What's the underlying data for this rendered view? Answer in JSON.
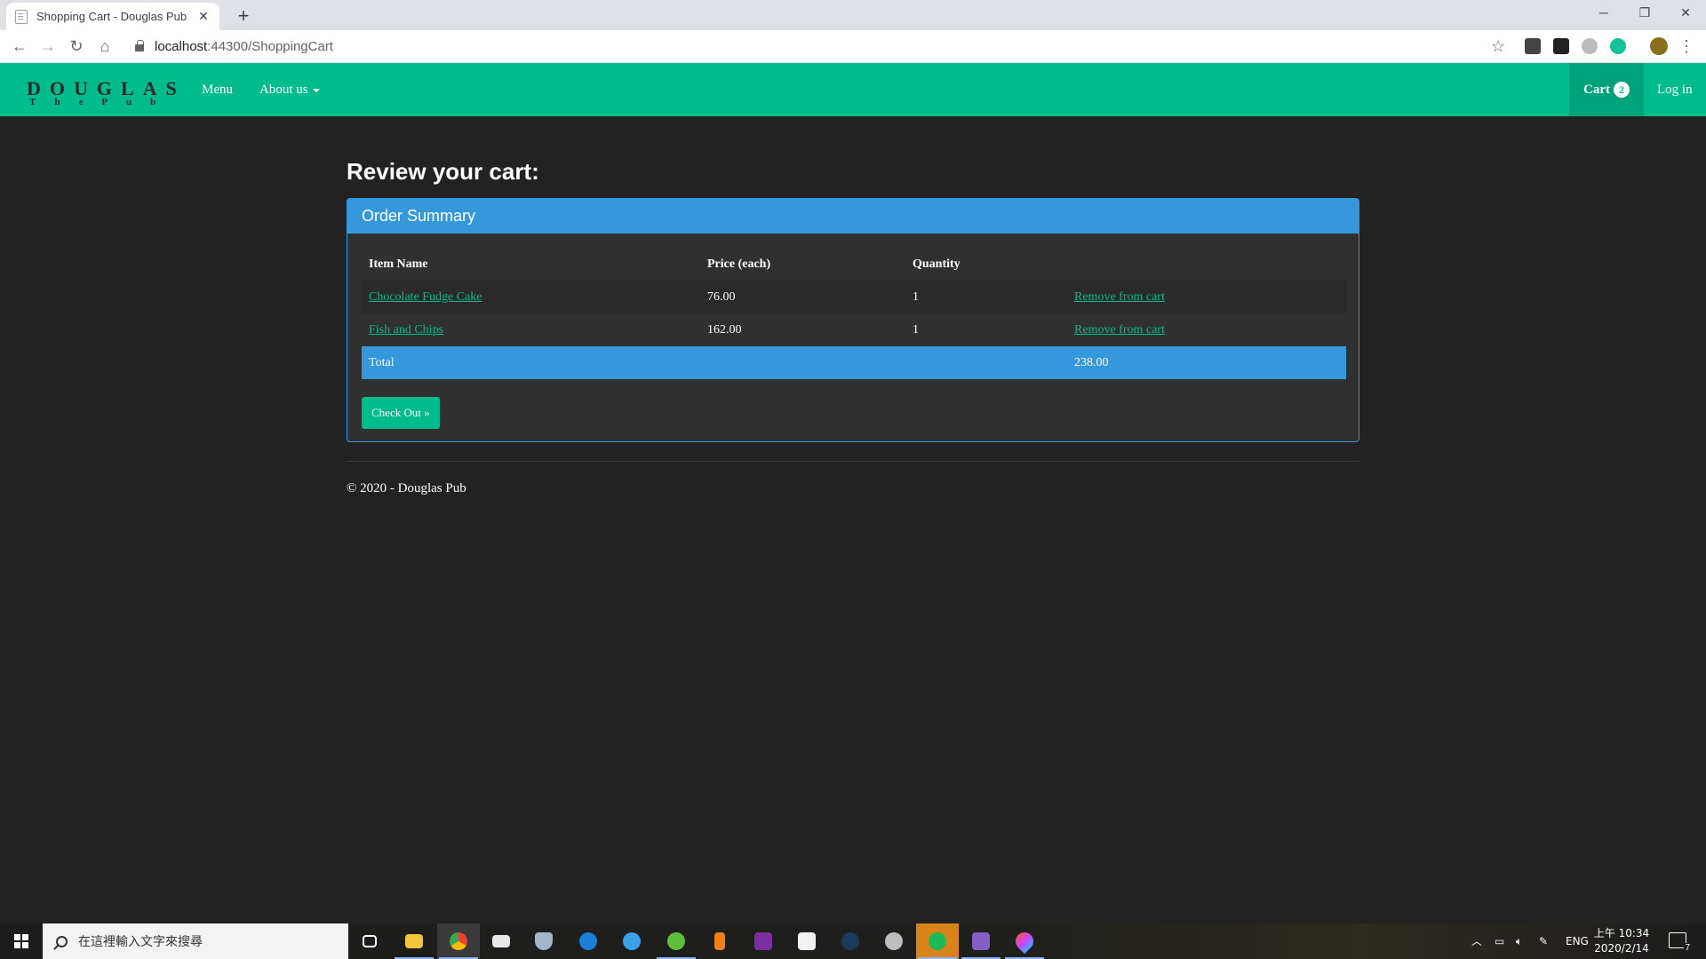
{
  "browser": {
    "tab_title": "Shopping Cart - Douglas Pub",
    "new_tab_glyph": "+",
    "close_tab_glyph": "✕",
    "url_host": "localhost",
    "url_rest": ":44300/ShoppingCart",
    "window_controls": {
      "minimize": "─",
      "restore": "❐",
      "close": "✕"
    }
  },
  "site": {
    "brand_line1": "DOUGLAS",
    "brand_line2": "ThePub",
    "nav": {
      "menu": "Menu",
      "about": "About us"
    },
    "cart_label": "Cart",
    "cart_count": "2",
    "login": "Log in",
    "colors": {
      "primary": "#00bc8c",
      "info": "#3498db",
      "background": "#222222"
    }
  },
  "page": {
    "heading": "Review your cart:",
    "panel_title": "Order Summary",
    "table": {
      "headers": [
        "Item Name",
        "Price (each)",
        "Quantity",
        ""
      ],
      "rows": [
        {
          "name": "Chocolate Fudge Cake",
          "price": "76.00",
          "qty": "1",
          "action": "Remove from cart"
        },
        {
          "name": "Fish and Chips",
          "price": "162.00",
          "qty": "1",
          "action": "Remove from cart"
        }
      ],
      "total_label": "Total",
      "total_value": "238.00"
    },
    "checkout_button": "Check Out »",
    "footer": "© 2020 - Douglas Pub"
  },
  "taskbar": {
    "search_placeholder": "在這裡輸入文字來搜尋",
    "language": "ENG",
    "time": "上午 10:34",
    "date": "2020/2/14",
    "notification_count": "7"
  }
}
